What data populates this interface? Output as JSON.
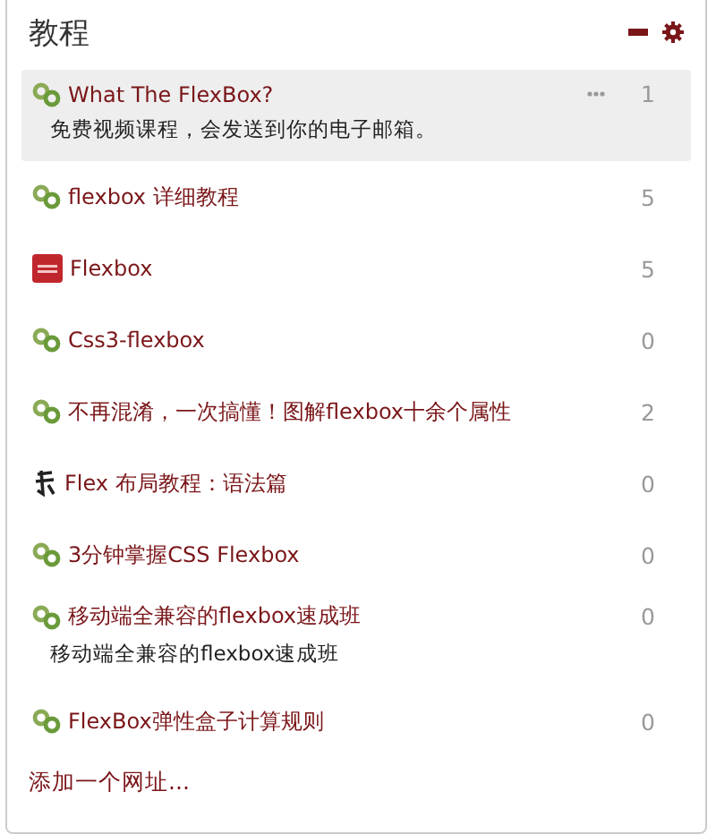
{
  "panel": {
    "title": "教程"
  },
  "items": [
    {
      "kind": "link",
      "title": "What The FlexBox?",
      "description": "免费视频课程，会发送到你的电子邮箱。",
      "count": "1",
      "selected": true
    },
    {
      "kind": "link",
      "title": "flexbox 详细教程",
      "count": "5",
      "selected": false
    },
    {
      "kind": "logo",
      "title": "Flexbox",
      "count": "5",
      "selected": false
    },
    {
      "kind": "link",
      "title": "Css3-flexbox",
      "count": "0",
      "selected": false
    },
    {
      "kind": "link",
      "title": "不再混淆，一次搞懂！图解flexbox十余个属性",
      "count": "2",
      "selected": false
    },
    {
      "kind": "brush",
      "title": "Flex 布局教程：语法篇",
      "count": "0",
      "selected": false
    },
    {
      "kind": "link",
      "title": "3分钟掌握CSS Flexbox",
      "count": "0",
      "selected": false
    },
    {
      "kind": "link",
      "title": "移动端全兼容的flexbox速成班",
      "description": "移动端全兼容的flexbox速成班",
      "count": "0",
      "selected": false
    },
    {
      "kind": "link",
      "title": "FlexBox弹性盒子计算规则",
      "count": "0",
      "selected": false
    }
  ],
  "footer": {
    "add_link": "添加一个网址..."
  }
}
